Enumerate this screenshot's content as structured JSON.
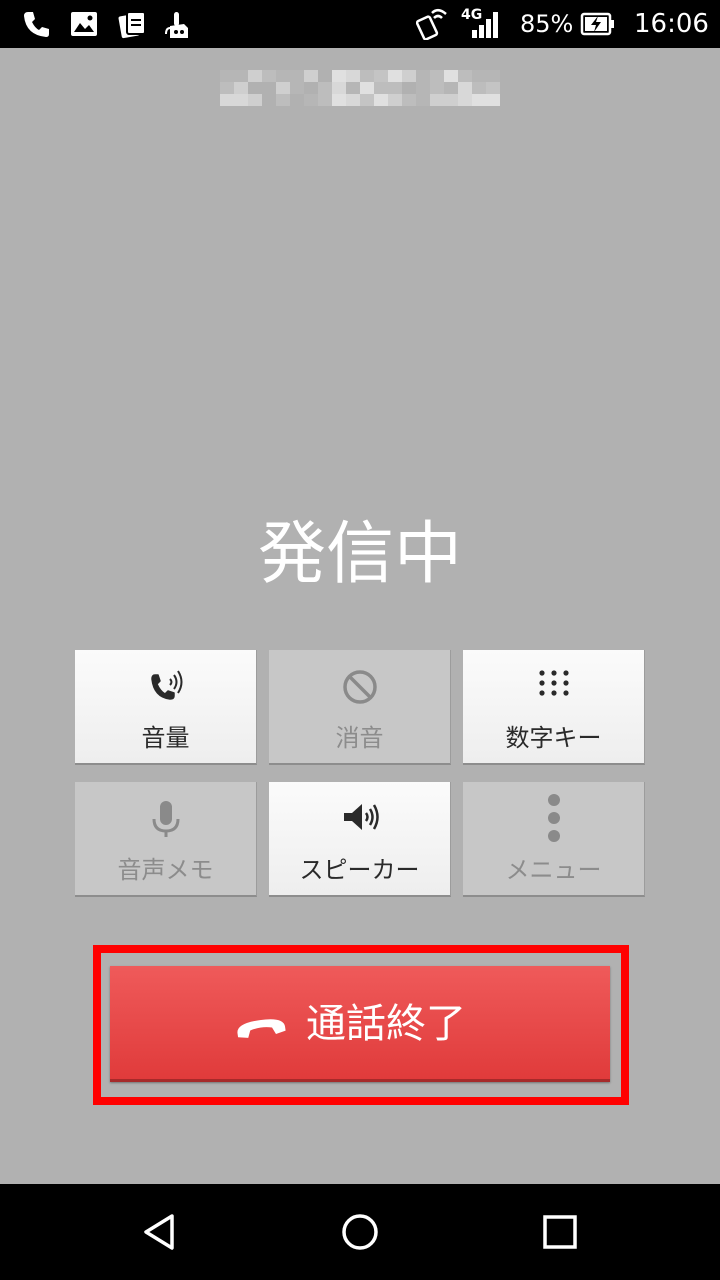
{
  "status_bar": {
    "icons_left": [
      "phone-icon",
      "gallery-icon",
      "cards-icon",
      "touch-icon"
    ],
    "icons_right": [
      "nfc-icon",
      "signal-icon",
      "battery-charging-icon"
    ],
    "network": "4G",
    "battery": "85%",
    "time": "16:06"
  },
  "call": {
    "status": "発信中"
  },
  "controls": [
    {
      "label": "音量",
      "icon": "volume-handset-icon",
      "enabled": true
    },
    {
      "label": "消音",
      "icon": "mute-icon",
      "enabled": false
    },
    {
      "label": "数字キー",
      "icon": "dialpad-icon",
      "enabled": true
    },
    {
      "label": "音声メモ",
      "icon": "microphone-icon",
      "enabled": false
    },
    {
      "label": "スピーカー",
      "icon": "speaker-icon",
      "enabled": true
    },
    {
      "label": "メニュー",
      "icon": "menu-dots-icon",
      "enabled": false
    }
  ],
  "end_call": {
    "label": "通話終了",
    "icon": "hang-up-icon"
  },
  "colors": {
    "background": "#b1b1b1",
    "end_call": "#e84a4a",
    "highlight": "#ff0000"
  },
  "nav_bar": {
    "buttons": [
      "back-icon",
      "home-icon",
      "recents-icon"
    ]
  }
}
